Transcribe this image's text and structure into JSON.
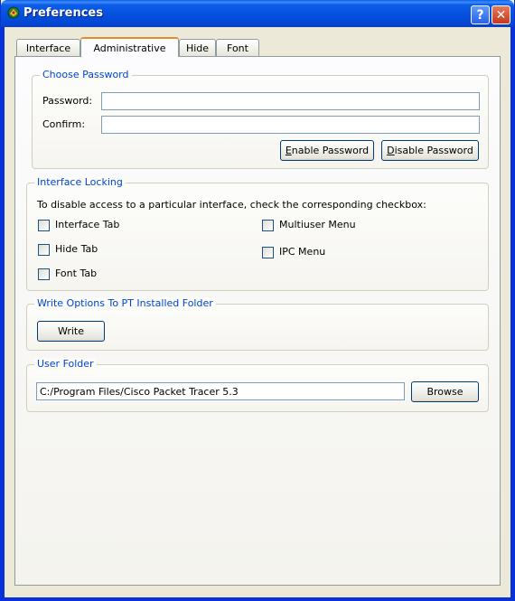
{
  "window": {
    "title": "Preferences",
    "help_label": "?",
    "close_label": "✕"
  },
  "tabs": [
    {
      "label": "Interface"
    },
    {
      "label": "Administrative",
      "active": true
    },
    {
      "label": "Hide"
    },
    {
      "label": "Font"
    }
  ],
  "password_group": {
    "title": "Choose Password",
    "password_label": "Password:",
    "password_value": "",
    "confirm_label": "Confirm:",
    "confirm_value": "",
    "enable_first": "E",
    "enable_rest": "nable Password",
    "disable_first": "D",
    "disable_rest": "isable Password"
  },
  "locking_group": {
    "title": "Interface Locking",
    "instruction": "To disable access to a particular interface, check the corresponding checkbox:",
    "checkboxes": [
      {
        "label": "Interface Tab",
        "checked": false
      },
      {
        "label": "Hide Tab",
        "checked": false
      },
      {
        "label": "Font Tab",
        "checked": false
      },
      {
        "label": "Multiuser Menu",
        "checked": false
      },
      {
        "label": "IPC Menu",
        "checked": false
      }
    ]
  },
  "write_group": {
    "title": "Write Options To PT Installed Folder",
    "write_label": "Write"
  },
  "user_folder_group": {
    "title": "User Folder",
    "path_value": "C:/Program Files/Cisco Packet Tracer 5.3",
    "browse_label": "Browse"
  },
  "icons": {
    "app": "packet-tracer-icon"
  },
  "colors": {
    "title_bar": "#0552de",
    "group_title": "#0046d5",
    "active_tab_accent": "#e68b2c",
    "close_button": "#c4381b"
  }
}
